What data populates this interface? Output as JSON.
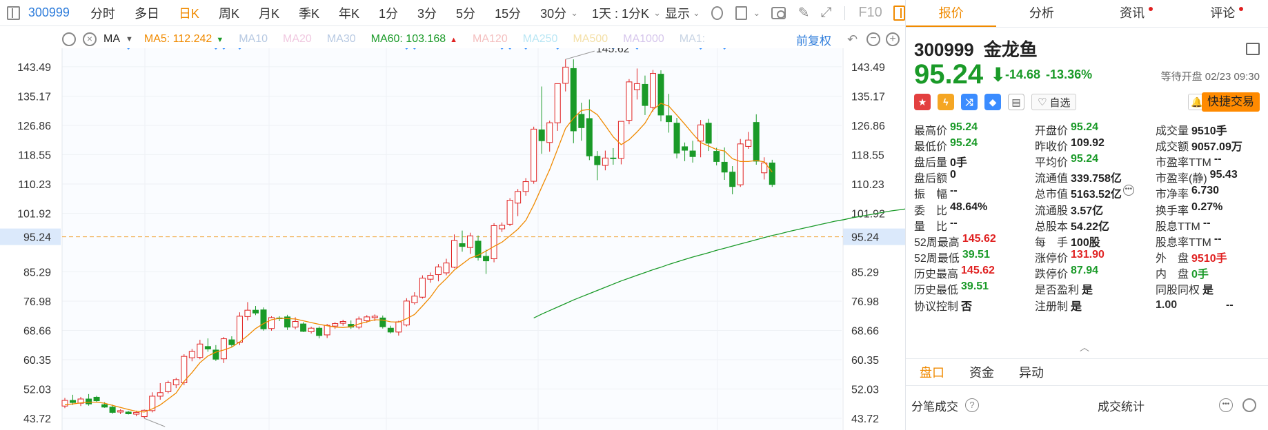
{
  "toolbar": {
    "code": "300999",
    "periods": [
      "分时",
      "多日",
      "日K",
      "周K",
      "月K",
      "季K",
      "年K",
      "1分",
      "3分",
      "5分",
      "15分",
      "30分"
    ],
    "active_period": "日K",
    "interval_select": "1天 : 1分K",
    "display_select": "显示",
    "f10": "F10"
  },
  "ma_row": {
    "label": "MA",
    "items": [
      {
        "text": "MA5: 112.242",
        "color": "#f08a00",
        "arrow": "down",
        "arrow_color": "#1a9a28"
      },
      {
        "text": "MA10",
        "color": "#b7c9e2"
      },
      {
        "text": "MA20",
        "color": "#f0c8e0"
      },
      {
        "text": "MA30",
        "color": "#b7c9e2"
      },
      {
        "text": "MA60: 103.168",
        "color": "#1a9a28",
        "arrow": "up",
        "arrow_color": "#e02020"
      },
      {
        "text": "MA120",
        "color": "#f4c0c0"
      },
      {
        "text": "MA250",
        "color": "#b8e6f4"
      },
      {
        "text": "MA500",
        "color": "#f4e0a8"
      },
      {
        "text": "MA1000",
        "color": "#d6c6ec"
      },
      {
        "text": "MA1:",
        "color": "#c8d4e4"
      }
    ],
    "restore_label": "前复权"
  },
  "chart_data": {
    "type": "candlestick",
    "y_ticks": [
      43.72,
      52.03,
      60.35,
      68.66,
      76.98,
      85.29,
      95.24,
      101.92,
      110.23,
      118.55,
      126.86,
      135.17,
      143.49
    ],
    "ylim": [
      40.4,
      146.8
    ],
    "current_price": 95.24,
    "max_label": "145.62",
    "min_label": "43.72",
    "colors": {
      "up": "#e02020",
      "down": "#1a9a28",
      "ma5": "#f08a00",
      "ma60": "#1a9a28",
      "current_line": "#f0a030",
      "marker": "#2f8cff"
    },
    "candles": [
      {
        "o": 47.2,
        "h": 49.5,
        "l": 46.6,
        "c": 48.8
      },
      {
        "o": 48.8,
        "h": 50.4,
        "l": 47.5,
        "c": 48.2
      },
      {
        "o": 48.0,
        "h": 49.8,
        "l": 47.2,
        "c": 49.2
      },
      {
        "o": 49.2,
        "h": 50.6,
        "l": 47.3,
        "c": 47.8
      },
      {
        "o": 49.7,
        "h": 50.1,
        "l": 48.2,
        "c": 48.7
      },
      {
        "o": 47.6,
        "h": 48.3,
        "l": 46.7,
        "c": 46.9
      },
      {
        "o": 46.9,
        "h": 47.6,
        "l": 45.0,
        "c": 45.4
      },
      {
        "o": 45.5,
        "h": 46.3,
        "l": 44.9,
        "c": 45.9
      },
      {
        "o": 45.5,
        "h": 45.8,
        "l": 44.8,
        "c": 45.0
      },
      {
        "o": 44.9,
        "h": 45.9,
        "l": 44.3,
        "c": 45.4
      },
      {
        "o": 44.2,
        "h": 46.2,
        "l": 43.7,
        "c": 46.0
      },
      {
        "o": 45.9,
        "h": 51.1,
        "l": 45.4,
        "c": 50.0
      },
      {
        "o": 50.0,
        "h": 53.7,
        "l": 49.0,
        "c": 51.0
      },
      {
        "o": 51.3,
        "h": 54.4,
        "l": 50.8,
        "c": 53.8
      },
      {
        "o": 53.2,
        "h": 55.2,
        "l": 52.3,
        "c": 54.7
      },
      {
        "o": 53.8,
        "h": 61.9,
        "l": 53.1,
        "c": 61.3
      },
      {
        "o": 60.9,
        "h": 63.4,
        "l": 59.9,
        "c": 62.7
      },
      {
        "o": 61.0,
        "h": 66.0,
        "l": 60.5,
        "c": 64.8
      },
      {
        "o": 64.1,
        "h": 66.4,
        "l": 62.6,
        "c": 63.4
      },
      {
        "o": 63.1,
        "h": 64.5,
        "l": 60.0,
        "c": 60.5
      },
      {
        "o": 60.6,
        "h": 66.8,
        "l": 59.4,
        "c": 66.3
      },
      {
        "o": 66.0,
        "h": 67.0,
        "l": 63.9,
        "c": 64.6
      },
      {
        "o": 65.3,
        "h": 73.8,
        "l": 64.5,
        "c": 72.7
      },
      {
        "o": 72.6,
        "h": 76.7,
        "l": 71.5,
        "c": 74.4
      },
      {
        "o": 74.4,
        "h": 75.6,
        "l": 73.0,
        "c": 73.6
      },
      {
        "o": 74.5,
        "h": 75.2,
        "l": 68.6,
        "c": 69.1
      },
      {
        "o": 69.2,
        "h": 72.7,
        "l": 68.6,
        "c": 72.3
      },
      {
        "o": 72.2,
        "h": 72.7,
        "l": 71.3,
        "c": 72.0
      },
      {
        "o": 72.5,
        "h": 73.1,
        "l": 68.8,
        "c": 69.6
      },
      {
        "o": 69.6,
        "h": 72.4,
        "l": 69.0,
        "c": 71.2
      },
      {
        "o": 70.5,
        "h": 71.0,
        "l": 68.2,
        "c": 68.4
      },
      {
        "o": 68.3,
        "h": 69.7,
        "l": 67.8,
        "c": 69.3
      },
      {
        "o": 69.3,
        "h": 69.8,
        "l": 66.4,
        "c": 67.2
      },
      {
        "o": 67.4,
        "h": 70.5,
        "l": 66.5,
        "c": 70.1
      },
      {
        "o": 69.9,
        "h": 71.0,
        "l": 69.1,
        "c": 70.6
      },
      {
        "o": 70.7,
        "h": 71.7,
        "l": 70.0,
        "c": 71.2
      },
      {
        "o": 70.4,
        "h": 71.5,
        "l": 69.1,
        "c": 69.6
      },
      {
        "o": 69.6,
        "h": 72.6,
        "l": 69.0,
        "c": 71.9
      },
      {
        "o": 71.4,
        "h": 73.0,
        "l": 70.8,
        "c": 72.5
      },
      {
        "o": 72.3,
        "h": 73.2,
        "l": 71.3,
        "c": 72.7
      },
      {
        "o": 72.2,
        "h": 72.9,
        "l": 69.2,
        "c": 69.7
      },
      {
        "o": 69.3,
        "h": 70.0,
        "l": 67.8,
        "c": 68.2
      },
      {
        "o": 68.2,
        "h": 71.4,
        "l": 67.2,
        "c": 71.1
      },
      {
        "o": 70.2,
        "h": 77.8,
        "l": 69.8,
        "c": 77.0
      },
      {
        "o": 76.5,
        "h": 79.5,
        "l": 76.0,
        "c": 78.4
      },
      {
        "o": 78.1,
        "h": 84.3,
        "l": 77.7,
        "c": 83.5
      },
      {
        "o": 83.2,
        "h": 85.1,
        "l": 82.2,
        "c": 84.3
      },
      {
        "o": 84.5,
        "h": 87.5,
        "l": 82.6,
        "c": 86.7
      },
      {
        "o": 85.0,
        "h": 89.0,
        "l": 84.3,
        "c": 87.8
      },
      {
        "o": 86.6,
        "h": 95.9,
        "l": 86.3,
        "c": 94.2
      },
      {
        "o": 93.3,
        "h": 97.0,
        "l": 91.0,
        "c": 92.5
      },
      {
        "o": 92.2,
        "h": 96.4,
        "l": 90.4,
        "c": 95.5
      },
      {
        "o": 94.0,
        "h": 95.6,
        "l": 88.5,
        "c": 89.4
      },
      {
        "o": 89.7,
        "h": 91.6,
        "l": 84.7,
        "c": 88.4
      },
      {
        "o": 89.0,
        "h": 99.1,
        "l": 88.0,
        "c": 98.4
      },
      {
        "o": 97.5,
        "h": 99.3,
        "l": 96.6,
        "c": 98.5
      },
      {
        "o": 98.8,
        "h": 106.2,
        "l": 98.3,
        "c": 105.6
      },
      {
        "o": 104.8,
        "h": 108.8,
        "l": 101.1,
        "c": 108.1
      },
      {
        "o": 108.1,
        "h": 111.9,
        "l": 106.9,
        "c": 110.9
      },
      {
        "o": 111.0,
        "h": 126.5,
        "l": 110.3,
        "c": 125.8
      },
      {
        "o": 125.6,
        "h": 137.9,
        "l": 118.8,
        "c": 122.5
      },
      {
        "o": 122.0,
        "h": 128.2,
        "l": 119.4,
        "c": 127.6
      },
      {
        "o": 127.6,
        "h": 138.7,
        "l": 125.3,
        "c": 138.7
      },
      {
        "o": 138.8,
        "h": 145.6,
        "l": 136.5,
        "c": 143.4
      },
      {
        "o": 143.0,
        "h": 145.6,
        "l": 121.8,
        "c": 125.3
      },
      {
        "o": 130.0,
        "h": 133.3,
        "l": 122.5,
        "c": 126.2
      },
      {
        "o": 128.8,
        "h": 134.2,
        "l": 117.0,
        "c": 118.2
      },
      {
        "o": 118.1,
        "h": 119.6,
        "l": 111.3,
        "c": 115.7
      },
      {
        "o": 115.5,
        "h": 119.7,
        "l": 114.1,
        "c": 117.6
      },
      {
        "o": 117.6,
        "h": 120.4,
        "l": 115.7,
        "c": 117.5
      },
      {
        "o": 117.5,
        "h": 121.4,
        "l": 115.8,
        "c": 128.0
      },
      {
        "o": 128.3,
        "h": 140.0,
        "l": 127.2,
        "c": 139.2
      },
      {
        "o": 137.0,
        "h": 143.0,
        "l": 134.2,
        "c": 138.7
      },
      {
        "o": 138.5,
        "h": 141.0,
        "l": 129.8,
        "c": 132.5
      },
      {
        "o": 132.0,
        "h": 142.6,
        "l": 130.8,
        "c": 141.6
      },
      {
        "o": 141.4,
        "h": 142.5,
        "l": 128.0,
        "c": 129.8
      },
      {
        "o": 129.6,
        "h": 135.8,
        "l": 124.8,
        "c": 127.9
      },
      {
        "o": 127.5,
        "h": 129.0,
        "l": 117.5,
        "c": 119.0
      },
      {
        "o": 120.8,
        "h": 122.0,
        "l": 116.7,
        "c": 119.8
      },
      {
        "o": 119.6,
        "h": 122.5,
        "l": 116.3,
        "c": 118.0
      },
      {
        "o": 122.4,
        "h": 128.4,
        "l": 117.8,
        "c": 127.0
      },
      {
        "o": 127.5,
        "h": 128.7,
        "l": 119.6,
        "c": 121.8
      },
      {
        "o": 119.5,
        "h": 120.5,
        "l": 115.5,
        "c": 116.6
      },
      {
        "o": 116.4,
        "h": 120.6,
        "l": 111.4,
        "c": 113.6
      },
      {
        "o": 113.6,
        "h": 115.3,
        "l": 107.3,
        "c": 109.5
      },
      {
        "o": 110.0,
        "h": 123.0,
        "l": 109.4,
        "c": 121.6
      },
      {
        "o": 120.9,
        "h": 125.0,
        "l": 120.2,
        "c": 122.7
      },
      {
        "o": 127.7,
        "h": 130.0,
        "l": 115.7,
        "c": 116.7
      },
      {
        "o": 113.4,
        "h": 117.8,
        "l": 111.5,
        "c": 116.2
      },
      {
        "o": 116.2,
        "h": 117.1,
        "l": 109.4,
        "c": 110.1
      }
    ],
    "ma5": [
      47.6,
      47.8,
      48.1,
      48.3,
      48.3,
      48.0,
      47.4,
      46.8,
      46.2,
      45.7,
      45.5,
      46.4,
      47.5,
      49.2,
      50.9,
      54.2,
      56.7,
      59.5,
      61.4,
      62.5,
      63.1,
      63.9,
      65.4,
      67.2,
      69.2,
      70.6,
      71.7,
      72.1,
      72.0,
      71.9,
      71.4,
      70.9,
      70.4,
      70.0,
      69.6,
      69.5,
      69.7,
      70.5,
      71.1,
      71.7,
      71.6,
      71.1,
      71.0,
      72.0,
      73.2,
      75.6,
      78.1,
      81.2,
      83.4,
      85.8,
      87.5,
      89.2,
      90.0,
      91.2,
      92.5,
      93.7,
      95.5,
      97.4,
      99.9,
      104.3,
      109.3,
      114.3,
      120.1,
      126.0,
      128.9,
      131.1,
      131.4,
      129.9,
      126.8,
      123.6,
      121.4,
      122.8,
      125.0,
      127.5,
      131.3,
      133.1,
      132.3,
      129.8,
      127.2,
      124.5,
      122.0,
      121.0,
      120.0,
      119.6,
      117.4,
      116.6,
      116.6,
      116.9,
      116.5,
      113.6
    ],
    "ma60_start_index": 59,
    "ma60": [
      72.2,
      73.3,
      74.3,
      75.3,
      76.3,
      77.3,
      78.2,
      79.1,
      80.0,
      80.9,
      81.8,
      82.7,
      83.5,
      84.3,
      85.1,
      85.9,
      86.6,
      87.4,
      88.1,
      88.8,
      89.5,
      90.1,
      90.7,
      91.4,
      92.0,
      92.6,
      93.2,
      93.8,
      94.4,
      95.0,
      95.6,
      96.1,
      96.7,
      97.2,
      97.7,
      98.2,
      98.7,
      99.2,
      99.7,
      100.1,
      100.6,
      101.0,
      101.4,
      101.8,
      102.2,
      102.6,
      102.9,
      103.2,
      103.5,
      103.2
    ]
  },
  "panel": {
    "tabs": [
      {
        "label": "报价",
        "active": true,
        "dot": false
      },
      {
        "label": "分析",
        "active": false,
        "dot": false
      },
      {
        "label": "资讯",
        "active": false,
        "dot": true
      },
      {
        "label": "评论",
        "active": false,
        "dot": true
      }
    ],
    "code": "300999",
    "name": "金龙鱼",
    "price": "95.24",
    "arrow": "⬇",
    "change": "-14.68",
    "change_pct": "-13.36%",
    "status": "等待开盘 02/23 09:30",
    "watch_label": "自选",
    "trade_button": "快捷交易",
    "quotes": [
      [
        {
          "label": "最高价",
          "value": "95.24",
          "cls": "green"
        },
        {
          "label": "开盘价",
          "value": "95.24",
          "cls": "green"
        },
        {
          "label": "成交量",
          "value": "9510手",
          "cls": ""
        }
      ],
      [
        {
          "label": "最低价",
          "value": "95.24",
          "cls": "green"
        },
        {
          "label": "昨收价",
          "value": "109.92",
          "cls": ""
        },
        {
          "label": "成交额",
          "value": "9057.09万",
          "cls": ""
        }
      ],
      [
        {
          "label": "盘后量",
          "value": "0手",
          "cls": ""
        },
        {
          "label": "平均价",
          "value": "95.24",
          "cls": "green"
        },
        {
          "label": "市盈率TTM",
          "value": "--",
          "cls": ""
        }
      ],
      [
        {
          "label": "盘后额",
          "value": "0",
          "cls": ""
        },
        {
          "label": "流通值",
          "value": "339.758亿",
          "cls": ""
        },
        {
          "label": "市盈率(静)",
          "value": "95.43",
          "cls": ""
        }
      ],
      [
        {
          "label": "振　幅",
          "value": "--",
          "cls": ""
        },
        {
          "label": "总市值",
          "value": "5163.52亿",
          "cls": "",
          "more": true
        },
        {
          "label": "市净率",
          "value": "6.730",
          "cls": ""
        }
      ],
      [
        {
          "label": "委　比",
          "value": "48.64%",
          "cls": ""
        },
        {
          "label": "流通股",
          "value": "3.57亿",
          "cls": ""
        },
        {
          "label": "换手率",
          "value": "0.27%",
          "cls": ""
        }
      ],
      [
        {
          "label": "量　比",
          "value": "--",
          "cls": ""
        },
        {
          "label": "总股本",
          "value": "54.22亿",
          "cls": ""
        },
        {
          "label": "股息TTM",
          "value": "--",
          "cls": ""
        }
      ],
      [
        {
          "label": "52周最高",
          "value": "145.62",
          "cls": "red"
        },
        {
          "label": "每　手",
          "value": "100股",
          "cls": ""
        },
        {
          "label": "股息率TTM",
          "value": "--",
          "cls": ""
        }
      ],
      [
        {
          "label": "52周最低",
          "value": "39.51",
          "cls": "green"
        },
        {
          "label": "涨停价",
          "value": "131.90",
          "cls": "red"
        },
        {
          "label": "外　盘",
          "value": "9510手",
          "cls": "red"
        }
      ],
      [
        {
          "label": "历史最高",
          "value": "145.62",
          "cls": "red"
        },
        {
          "label": "跌停价",
          "value": "87.94",
          "cls": "green"
        },
        {
          "label": "内　盘",
          "value": "0手",
          "cls": "green"
        }
      ],
      [
        {
          "label": "历史最低",
          "value": "39.51",
          "cls": "green"
        },
        {
          "label": "是否盈利",
          "value": "是",
          "cls": ""
        },
        {
          "label": "同股同权",
          "value": "是",
          "cls": ""
        }
      ],
      [
        {
          "label": "协议控制",
          "value": "否",
          "cls": ""
        },
        {
          "label": "注册制",
          "value": "是",
          "cls": ""
        },
        {
          "label": "1.00",
          "value": "--",
          "cls": ""
        }
      ]
    ],
    "sub_tabs": [
      "盘口",
      "资金",
      "异动"
    ],
    "trade_label": "分笔成交",
    "stat_label": "成交统计"
  }
}
